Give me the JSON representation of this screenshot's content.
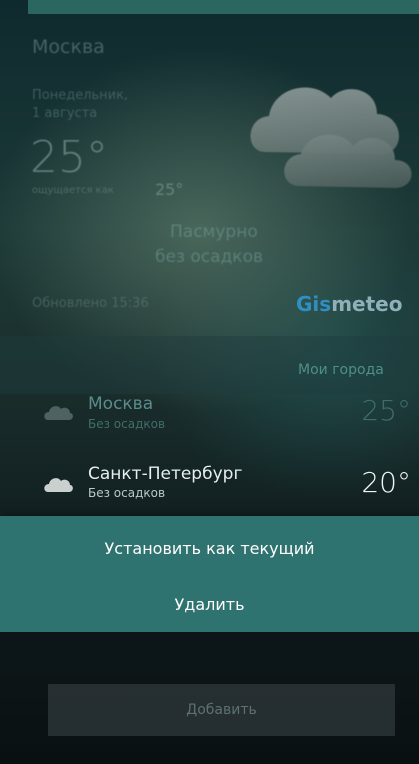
{
  "weather": {
    "city": "Москва",
    "date_line1": "Понедельник,",
    "date_line2": "1 августа",
    "temperature": "25°",
    "feels_like_label": "ощущается как",
    "feels_like_value": "25°",
    "condition_line1": "Пасмурно",
    "condition_line2": "без осадков",
    "updated": "Обновлено 15:36",
    "icon": "cloud-icon"
  },
  "brand": {
    "part1": "Gis",
    "part2": "meteo",
    "part1_color": "#2f8fc4"
  },
  "cities": {
    "header": "Мои города",
    "items": [
      {
        "name": "Москва",
        "condition": "Без осадков",
        "temp": "25°",
        "icon": "cloud-icon"
      },
      {
        "name": "Санкт-Петербург",
        "condition": "Без осадков",
        "temp": "20°",
        "icon": "cloud-icon"
      }
    ]
  },
  "context_menu": {
    "set_current": "Установить как текущий",
    "delete": "Удалить",
    "color": "#2f7370"
  },
  "add_button": {
    "label": "Добавить"
  }
}
